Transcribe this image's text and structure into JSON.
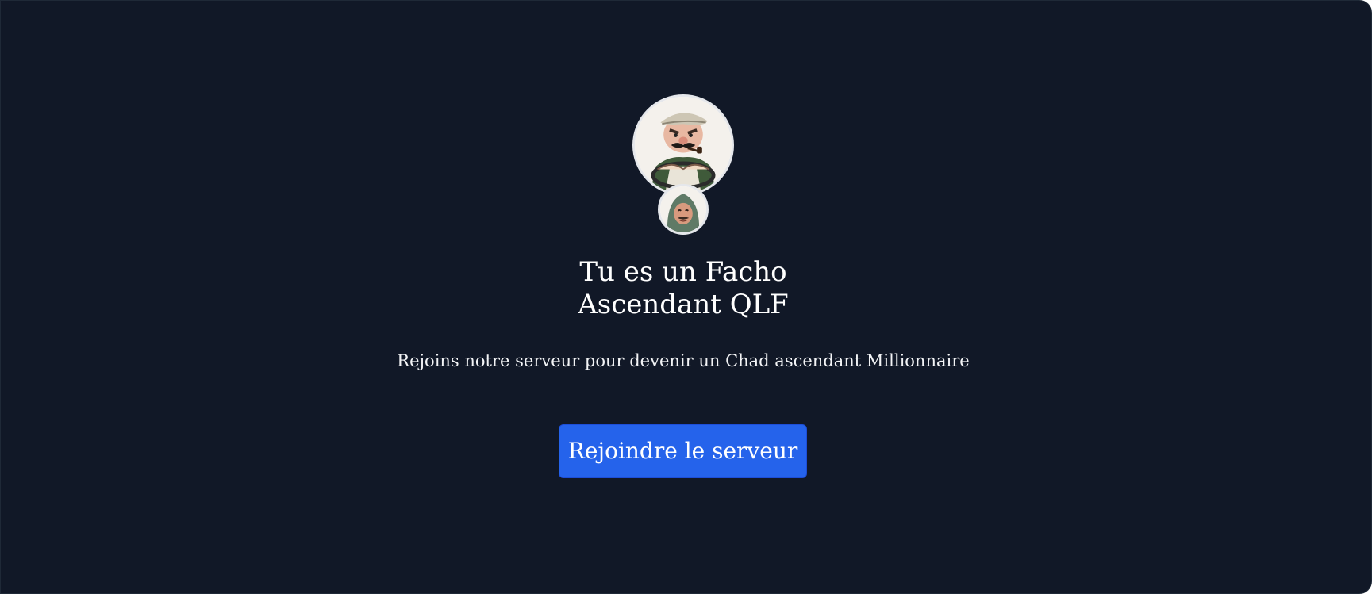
{
  "invite": {
    "title_line1": "Tu es un Facho",
    "title_line2": "Ascendant QLF",
    "description": "Rejoins notre serveur pour devenir un Chad ascendant Millionnaire",
    "join_button_label": "Rejoindre le serveur"
  },
  "avatars": {
    "server_icon": "server-avatar-cartoon-man-with-pipe",
    "inviter_icon": "inviter-avatar-man-with-headscarf"
  },
  "colors": {
    "background": "#111827",
    "button": "#2563eb",
    "text": "#ffffff"
  }
}
